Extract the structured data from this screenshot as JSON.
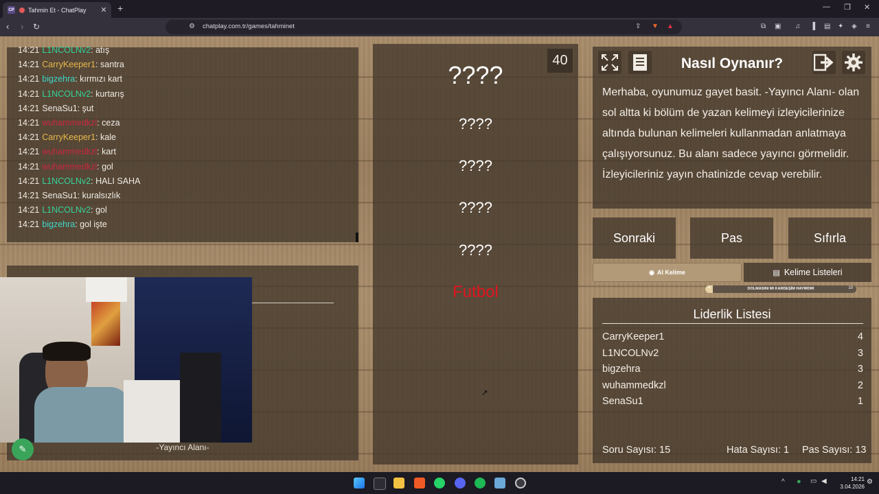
{
  "browser": {
    "tab_title": "Tahmin Et - ChatPlay",
    "tab_badge": "CP",
    "url": "chatplay.com.tr/games/tahminet",
    "new_tab": "+",
    "close": "✕"
  },
  "timer": "40",
  "chat": {
    "messages": [
      {
        "time": "14:21",
        "user": "L1NCOLNv2",
        "color": "#35d49a",
        "text": ": atış"
      },
      {
        "time": "14:21",
        "user": "CarryKeeper1",
        "color": "#e8b84a",
        "text": ": santra"
      },
      {
        "time": "14:21",
        "user": "bigzehra",
        "color": "#3fd8c8",
        "text": ": kırmızı kart"
      },
      {
        "time": "14:21",
        "user": "L1NCOLNv2",
        "color": "#35d49a",
        "text": ": kurtarış"
      },
      {
        "time": "14:21",
        "user": "SenaSu1",
        "color": "#f1ece4",
        "text": ": şut"
      },
      {
        "time": "14:21",
        "user": "wuhammedkzl",
        "color": "#c8283e",
        "text": ": ceza"
      },
      {
        "time": "14:21",
        "user": "CarryKeeper1",
        "color": "#e8b84a",
        "text": ": kale"
      },
      {
        "time": "14:21",
        "user": "wuhammedkzl",
        "color": "#c8283e",
        "text": ": kart"
      },
      {
        "time": "14:21",
        "user": "wuhammedkzl",
        "color": "#c8283e",
        "text": ": gol"
      },
      {
        "time": "14:21",
        "user": "L1NCOLNv2",
        "color": "#35d49a",
        "text": ": HALI SAHA"
      },
      {
        "time": "14:21",
        "user": "SenaSu1",
        "color": "#f1ece4",
        "text": ": kuralsızlık"
      },
      {
        "time": "14:21",
        "user": "L1NCOLNv2",
        "color": "#35d49a",
        "text": ": gol"
      },
      {
        "time": "14:21",
        "user": "bigzehra",
        "color": "#3fd8c8",
        "text": ": gol işte"
      }
    ]
  },
  "streamer_area_label": "-Yayıncı Alanı-",
  "words": {
    "hidden_main": "????",
    "hidden": [
      "????",
      "????",
      "????",
      "????"
    ],
    "revealed": "Futbol"
  },
  "how_to": {
    "title": "Nasıl Oynanır?",
    "text": "Merhaba, oyunumuz gayet basit. -Yayıncı Alanı- olan sol altta ki bölüm de yazan kelimeyi izleyicilerinize altında bulunan kelimeleri kullanmadan anlatmaya çalışıyorsunuz. Bu alanı sadece yayıncı görmelidir. İzleyicileriniz yayın chatinizde cevap verebilir."
  },
  "buttons": {
    "next": "Sonraki",
    "pass": "Pas",
    "reset": "Sıfırla",
    "ai_word": "AI Kelime",
    "word_lists": "Kelime Listeleri"
  },
  "progress": {
    "label": "DOLMASINI MI KARDEŞİM HAYIRDIR",
    "min": "4",
    "max": "10",
    "fraction": 0.05
  },
  "leaderboard": {
    "title": "Liderlik Listesi",
    "rows": [
      {
        "name": "CarryKeeper1",
        "score": "4"
      },
      {
        "name": "L1NCOLNv2",
        "score": "3"
      },
      {
        "name": "bigzehra",
        "score": "3"
      },
      {
        "name": "wuhammedkzl",
        "score": "2"
      },
      {
        "name": "SenaSu1",
        "score": "1"
      }
    ]
  },
  "stats": {
    "questions": "Soru Sayısı: 15",
    "errors": "Hata Sayısı: 1",
    "passes": "Pas Sayısı: 13"
  },
  "taskbar": {
    "time": "14:21",
    "date": "3.04.2026"
  }
}
